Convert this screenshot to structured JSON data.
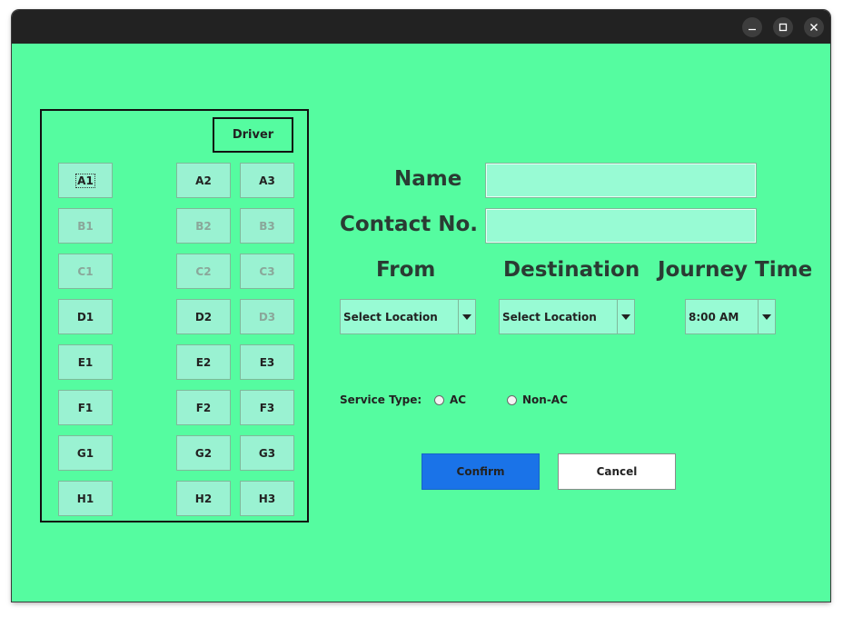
{
  "window": {
    "controls": {
      "minimize_icon": "minimize-icon",
      "maximize_icon": "maximize-icon",
      "close_icon": "close-icon"
    },
    "background_color": "#55fca0",
    "titlebar_color": "#222222"
  },
  "seat_panel": {
    "driver_label": "Driver",
    "seats": {
      "A1": "A1",
      "A2": "A2",
      "A3": "A3",
      "B1": "B1",
      "B2": "B2",
      "B3": "B3",
      "C1": "C1",
      "C2": "C2",
      "C3": "C3",
      "D1": "D1",
      "D2": "D2",
      "D3": "D3",
      "E1": "E1",
      "E2": "E2",
      "E3": "E3",
      "F1": "F1",
      "F2": "F2",
      "F3": "F3",
      "G1": "G1",
      "G2": "G2",
      "G3": "G3",
      "H1": "H1",
      "H2": "H2",
      "H3": "H3"
    },
    "disabled_seats": [
      "B1",
      "B2",
      "B3",
      "C1",
      "C2",
      "C3",
      "D3"
    ],
    "focused_seat": "A1"
  },
  "form": {
    "name_label": "Name",
    "name_value": "",
    "contact_label": "Contact No.",
    "contact_value": "",
    "from_label": "From",
    "from_value": "Select Location",
    "destination_label": "Destination",
    "destination_value": "Select Location",
    "journey_time_label": "Journey Time",
    "journey_time_value": "8:00 AM",
    "service_type_label": "Service Type:",
    "service_options": [
      "AC",
      "Non-AC"
    ],
    "confirm_label": "Confirm",
    "cancel_label": "Cancel",
    "confirm_color": "#1a73e8"
  }
}
